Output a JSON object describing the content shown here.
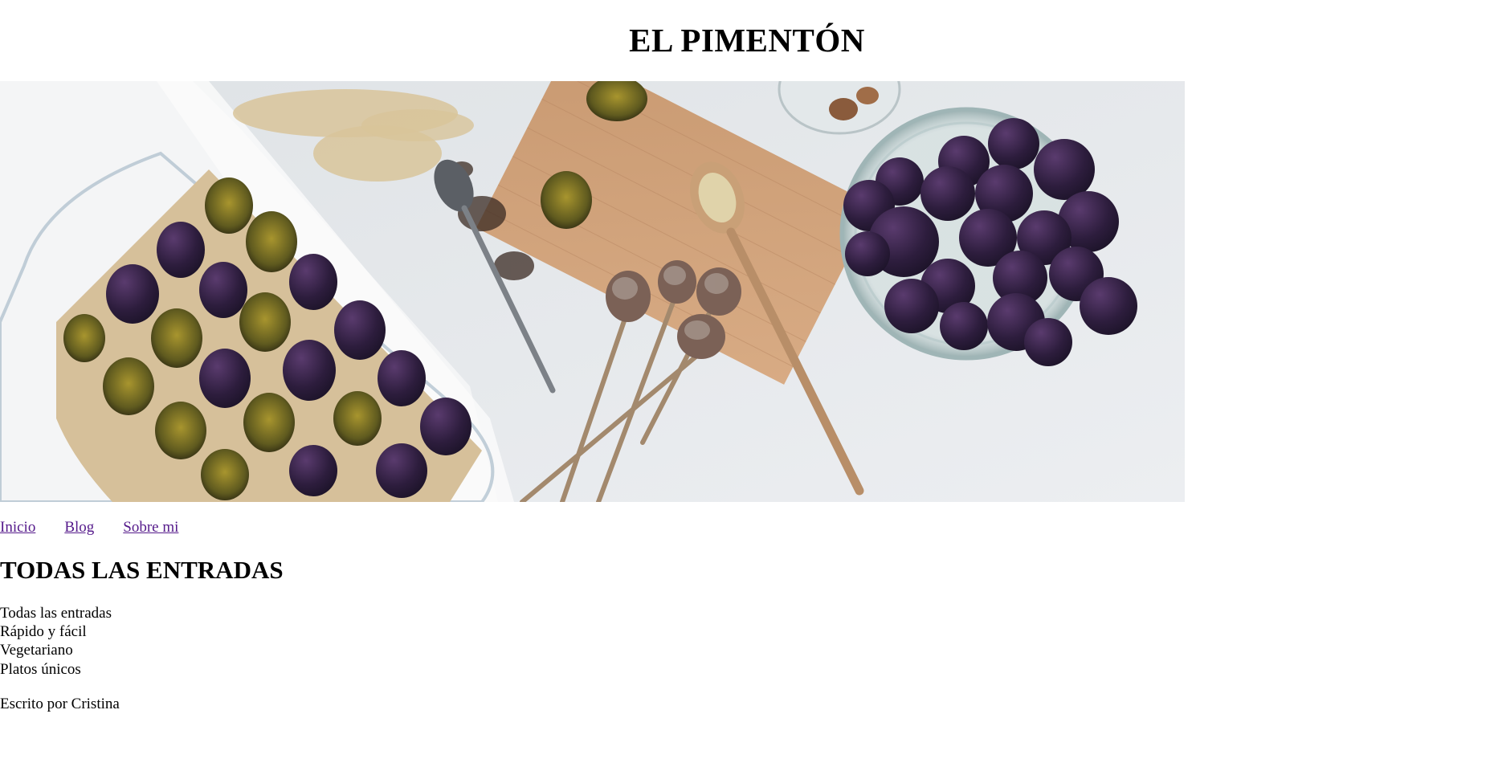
{
  "site": {
    "title": "EL PIMENTÓN"
  },
  "nav": {
    "items": [
      {
        "label": "Inicio"
      },
      {
        "label": "Blog"
      },
      {
        "label": "Sobre mi"
      }
    ],
    "link_color": "#551a8b"
  },
  "main": {
    "heading": "TODAS LAS ENTRADAS",
    "categories": [
      {
        "label": "Todas las entradas"
      },
      {
        "label": "Rápido y fácil"
      },
      {
        "label": "Vegetariano"
      },
      {
        "label": "Platos únicos"
      }
    ],
    "author_line": "Escrito por Cristina"
  },
  "hero_image": {
    "subject": "food-flatlay-plums-baking-tray-cutting-board"
  }
}
